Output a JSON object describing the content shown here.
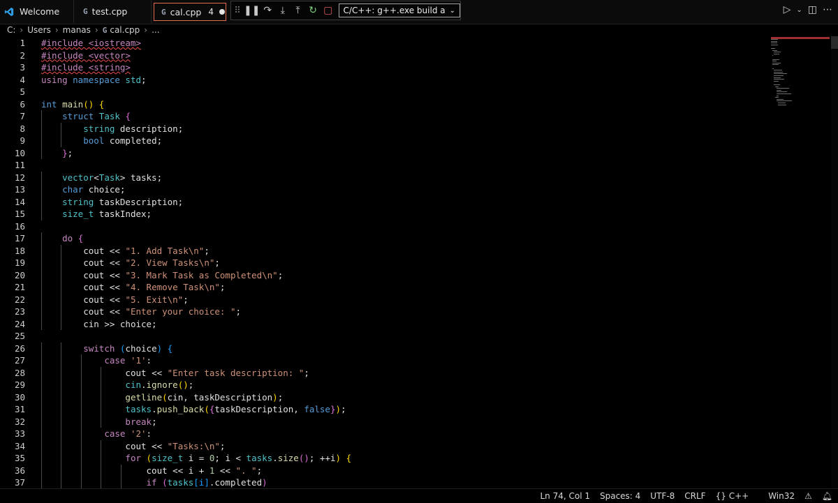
{
  "tabs": [
    {
      "label": "Welcome"
    },
    {
      "label": "test.cpp",
      "icon": "G"
    },
    {
      "label": "cal.cpp",
      "icon": "G",
      "problems": "4"
    }
  ],
  "debug": {
    "config_label": "C/C++: g++.exe build a"
  },
  "breadcrumb": [
    "C:",
    "Users",
    "manas",
    "cal.cpp",
    "..."
  ],
  "code_lines": [
    [
      [
        "#include <iostream>",
        "kw squig"
      ]
    ],
    [
      [
        "#include <vector>",
        "kw squig"
      ]
    ],
    [
      [
        "#include <string>",
        "kw squig"
      ]
    ],
    [
      [
        "using ",
        "kw"
      ],
      [
        "namespace ",
        "blue"
      ],
      [
        "std",
        "ty"
      ],
      [
        ";",
        "id"
      ]
    ],
    [],
    [
      [
        "int ",
        "blue"
      ],
      [
        "main",
        "fn"
      ],
      [
        "() ",
        "br1"
      ],
      [
        "{",
        "br1"
      ]
    ],
    [
      [
        "    ",
        ""
      ],
      [
        "struct ",
        "blue"
      ],
      [
        "Task ",
        "ty"
      ],
      [
        "{",
        "br2"
      ]
    ],
    [
      [
        "        ",
        ""
      ],
      [
        "string ",
        "ty"
      ],
      [
        "description;",
        "id"
      ]
    ],
    [
      [
        "        ",
        ""
      ],
      [
        "bool ",
        "blue"
      ],
      [
        "completed;",
        "id"
      ]
    ],
    [
      [
        "    ",
        ""
      ],
      [
        "}",
        "br2"
      ],
      [
        ";",
        "id"
      ]
    ],
    [],
    [
      [
        "    ",
        ""
      ],
      [
        "vector",
        "ty"
      ],
      [
        "<",
        "id"
      ],
      [
        "Task",
        "ty"
      ],
      [
        "> tasks;",
        "id"
      ]
    ],
    [
      [
        "    ",
        ""
      ],
      [
        "char ",
        "blue"
      ],
      [
        "choice;",
        "id"
      ]
    ],
    [
      [
        "    ",
        ""
      ],
      [
        "string ",
        "ty"
      ],
      [
        "taskDescription;",
        "id"
      ]
    ],
    [
      [
        "    ",
        ""
      ],
      [
        "size_t ",
        "ty"
      ],
      [
        "taskIndex;",
        "id"
      ]
    ],
    [],
    [
      [
        "    ",
        ""
      ],
      [
        "do ",
        "kw"
      ],
      [
        "{",
        "br2"
      ]
    ],
    [
      [
        "        ",
        ""
      ],
      [
        "cout ",
        "id"
      ],
      [
        "<< ",
        "id"
      ],
      [
        "\"1. Add Task\\n\"",
        "str"
      ],
      [
        ";",
        "id"
      ]
    ],
    [
      [
        "        ",
        ""
      ],
      [
        "cout ",
        "id"
      ],
      [
        "<< ",
        "id"
      ],
      [
        "\"2. View Tasks\\n\"",
        "str"
      ],
      [
        ";",
        "id"
      ]
    ],
    [
      [
        "        ",
        ""
      ],
      [
        "cout ",
        "id"
      ],
      [
        "<< ",
        "id"
      ],
      [
        "\"3. Mark Task as Completed\\n\"",
        "str"
      ],
      [
        ";",
        "id"
      ]
    ],
    [
      [
        "        ",
        ""
      ],
      [
        "cout ",
        "id"
      ],
      [
        "<< ",
        "id"
      ],
      [
        "\"4. Remove Task\\n\"",
        "str"
      ],
      [
        ";",
        "id"
      ]
    ],
    [
      [
        "        ",
        ""
      ],
      [
        "cout ",
        "id"
      ],
      [
        "<< ",
        "id"
      ],
      [
        "\"5. Exit\\n\"",
        "str"
      ],
      [
        ";",
        "id"
      ]
    ],
    [
      [
        "        ",
        ""
      ],
      [
        "cout ",
        "id"
      ],
      [
        "<< ",
        "id"
      ],
      [
        "\"Enter your choice: \"",
        "str"
      ],
      [
        ";",
        "id"
      ]
    ],
    [
      [
        "        ",
        ""
      ],
      [
        "cin ",
        "id"
      ],
      [
        ">> ",
        "id"
      ],
      [
        "choice;",
        "id"
      ]
    ],
    [],
    [
      [
        "        ",
        ""
      ],
      [
        "switch ",
        "kw"
      ],
      [
        "(",
        "br3"
      ],
      [
        "choice",
        "id"
      ],
      [
        ") ",
        "br3"
      ],
      [
        "{",
        "br3"
      ]
    ],
    [
      [
        "            ",
        ""
      ],
      [
        "case ",
        "kw"
      ],
      [
        "'1'",
        "str"
      ],
      [
        ":",
        "id"
      ]
    ],
    [
      [
        "                ",
        ""
      ],
      [
        "cout ",
        "id"
      ],
      [
        "<< ",
        "id"
      ],
      [
        "\"Enter task description: \"",
        "str"
      ],
      [
        ";",
        "id"
      ]
    ],
    [
      [
        "                ",
        ""
      ],
      [
        "cin",
        "ty"
      ],
      [
        ".",
        "id"
      ],
      [
        "ignore",
        "fn"
      ],
      [
        "()",
        "br1"
      ],
      [
        ";",
        "id"
      ]
    ],
    [
      [
        "                ",
        ""
      ],
      [
        "getline",
        "fn"
      ],
      [
        "(",
        "br1"
      ],
      [
        "cin, taskDescription",
        "id"
      ],
      [
        ")",
        "br1"
      ],
      [
        ";",
        "id"
      ]
    ],
    [
      [
        "                ",
        ""
      ],
      [
        "tasks",
        "ty"
      ],
      [
        ".",
        "id"
      ],
      [
        "push_back",
        "fn"
      ],
      [
        "(",
        "br1"
      ],
      [
        "{",
        "br2"
      ],
      [
        "taskDescription, ",
        "id"
      ],
      [
        "false",
        "blue"
      ],
      [
        "}",
        "br2"
      ],
      [
        ")",
        "br1"
      ],
      [
        ";",
        "id"
      ]
    ],
    [
      [
        "                ",
        ""
      ],
      [
        "break",
        "kw"
      ],
      [
        ";",
        "id"
      ]
    ],
    [
      [
        "            ",
        ""
      ],
      [
        "case ",
        "kw"
      ],
      [
        "'2'",
        "str"
      ],
      [
        ":",
        "id"
      ]
    ],
    [
      [
        "                ",
        ""
      ],
      [
        "cout ",
        "id"
      ],
      [
        "<< ",
        "id"
      ],
      [
        "\"Tasks:\\n\"",
        "str"
      ],
      [
        ";",
        "id"
      ]
    ],
    [
      [
        "                ",
        ""
      ],
      [
        "for ",
        "kw"
      ],
      [
        "(",
        "br1"
      ],
      [
        "size_t ",
        "ty"
      ],
      [
        "i = ",
        "id"
      ],
      [
        "0",
        "num"
      ],
      [
        "; i < ",
        "id"
      ],
      [
        "tasks",
        "ty"
      ],
      [
        ".",
        "id"
      ],
      [
        "size",
        "fn"
      ],
      [
        "()",
        "br2"
      ],
      [
        "; ++i",
        "id"
      ],
      [
        ") ",
        "br1"
      ],
      [
        "{",
        "br1"
      ]
    ],
    [
      [
        "                    ",
        ""
      ],
      [
        "cout ",
        "id"
      ],
      [
        "<< i + ",
        "id"
      ],
      [
        "1",
        "num"
      ],
      [
        " << ",
        "id"
      ],
      [
        "\". \"",
        "str"
      ],
      [
        ";",
        "id"
      ]
    ],
    [
      [
        "                    ",
        ""
      ],
      [
        "if ",
        "kw"
      ],
      [
        "(",
        "br2"
      ],
      [
        "tasks",
        "ty"
      ],
      [
        "[i]",
        "br3"
      ],
      [
        ".completed",
        "id"
      ],
      [
        ")",
        "br2"
      ]
    ]
  ],
  "status": {
    "position": "Ln 74, Col 1",
    "spaces": "Spaces: 4",
    "encoding": "UTF-8",
    "eol": "CRLF",
    "language": "C++",
    "platform": "Win32"
  },
  "colors": {
    "accent": "#e06c4a",
    "string": "#ce9178",
    "keyword": "#c586c0",
    "type": "#4fc1c9"
  }
}
